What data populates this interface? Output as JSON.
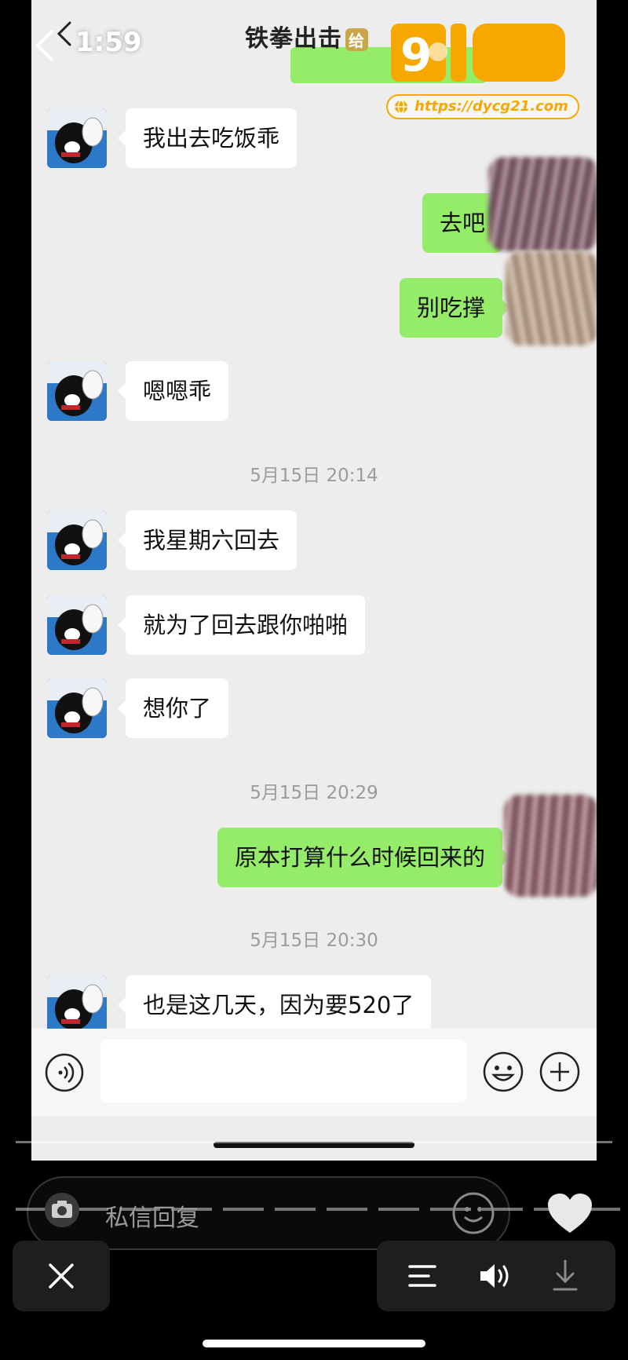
{
  "status_bar": {
    "time": "1:59"
  },
  "chat": {
    "title": "铁拳出击",
    "title_badge": "给",
    "messages": [
      {
        "side": "in",
        "text": "我出去吃饭乖"
      },
      {
        "side": "out",
        "text": "去吧"
      },
      {
        "side": "out",
        "text": "别吃撑"
      },
      {
        "side": "in",
        "text": "嗯嗯乖"
      },
      {
        "type": "time",
        "text": "5月15日 20:14"
      },
      {
        "side": "in",
        "text": "我星期六回去"
      },
      {
        "side": "in",
        "text": "就为了回去跟你啪啪"
      },
      {
        "side": "in",
        "text": "想你了"
      },
      {
        "type": "time",
        "text": "5月15日 20:29"
      },
      {
        "side": "out",
        "text": "原本打算什么时候回来的"
      },
      {
        "type": "time",
        "text": "5月15日 20:30"
      },
      {
        "side": "in",
        "text": "也是这几天，因为要520了"
      }
    ]
  },
  "watermark": {
    "url": "https://dycg21.com",
    "logo_icon": "brand-logo-icon",
    "colors": {
      "orange": "#f6a800"
    }
  },
  "input_bar": {
    "value": "",
    "icons": [
      "voice-icon",
      "emoji-icon",
      "plus-icon"
    ]
  },
  "video_overlay": {
    "reply_placeholder": "私信回复",
    "icons": [
      "camera-icon",
      "smile-icon",
      "heart-icon",
      "close-icon",
      "menu-icon",
      "speaker-icon",
      "download-icon"
    ]
  },
  "colors": {
    "bubble_out": "#95ec69",
    "bubble_in": "#ffffff",
    "chat_bg": "#ededed"
  }
}
